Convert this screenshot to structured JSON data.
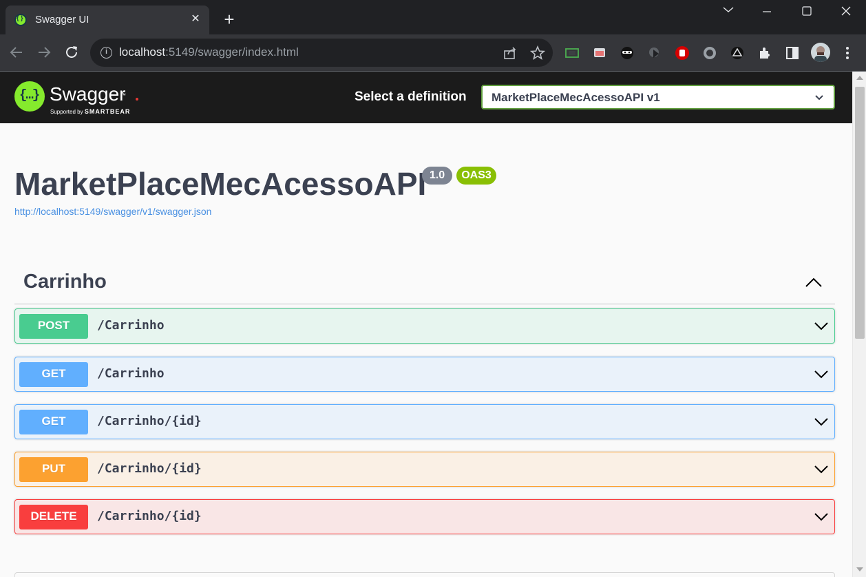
{
  "browser": {
    "tab_title": "Swagger UI",
    "tab_close": "✕",
    "new_tab": "+",
    "url_host": "localhost",
    "url_path": ":5149/swagger/index.html",
    "info_glyph": "i"
  },
  "swagger": {
    "brand": "Swagger",
    "brand_mark": "{…}",
    "registered": "™",
    "supported_prefix": "Supported by",
    "supported_brand": "SMARTBEAR",
    "definition_label": "Select a definition",
    "definition_value": "MarketPlaceMecAcessoAPI v1"
  },
  "info": {
    "title": "MarketPlaceMecAcessoAPI",
    "version": "1.0",
    "oas_badge": "OAS3",
    "spec_url": "http://localhost:5149/swagger/v1/swagger.json"
  },
  "tag": {
    "name": "Carrinho",
    "expanded": true
  },
  "operations": [
    {
      "method": "POST",
      "path": "/Carrinho"
    },
    {
      "method": "GET",
      "path": "/Carrinho"
    },
    {
      "method": "GET",
      "path": "/Carrinho/{id}"
    },
    {
      "method": "PUT",
      "path": "/Carrinho/{id}"
    },
    {
      "method": "DELETE",
      "path": "/Carrinho/{id}"
    }
  ],
  "colors": {
    "post": "#49cc90",
    "get": "#61affe",
    "put": "#fca130",
    "delete": "#f93e3e",
    "swagger_green": "#85ea2d",
    "topbar": "#1b1b1b"
  },
  "icons": {
    "toolbar": [
      "back-icon",
      "forward-icon",
      "reload-icon",
      "info-icon",
      "share-icon",
      "bookmark-star-icon"
    ],
    "extensions": [
      "screenshot-icon",
      "cast-icon",
      "incognito-mask-icon",
      "play-icon",
      "stop-hand-icon",
      "circle-icon",
      "alien-icon",
      "puzzle-icon",
      "side-panel-icon",
      "profile-avatar",
      "menu-kebab-icon"
    ]
  }
}
